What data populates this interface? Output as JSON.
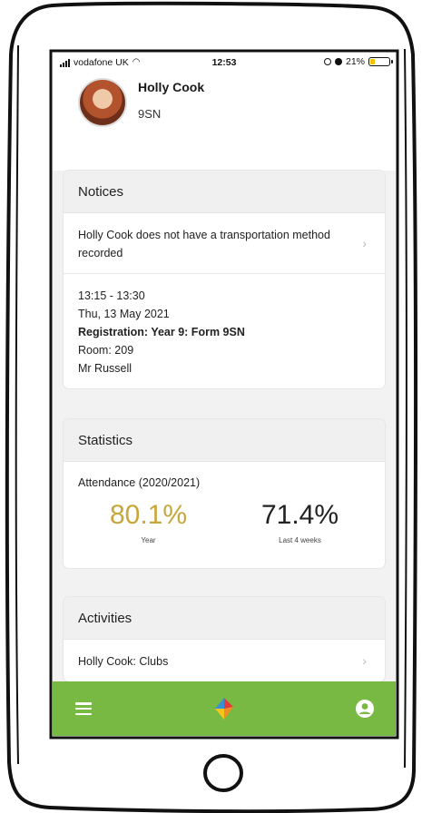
{
  "status_bar": {
    "carrier": "vodafone UK",
    "time": "12:53",
    "battery": "21%"
  },
  "profile": {
    "name": "Holly Cook",
    "form": "9SN"
  },
  "notices": {
    "title": "Notices",
    "transport_notice": "Holly Cook does not have a transportation method recorded",
    "registration": {
      "time": "13:15 - 13:30",
      "date": "Thu, 13 May 2021",
      "title": "Registration: Year 9: Form 9SN",
      "room": "Room: 209",
      "teacher": "Mr Russell"
    }
  },
  "statistics": {
    "title": "Statistics",
    "attendance_label": "Attendance (2020/2021)",
    "year_value": "80.1%",
    "year_caption": "Year",
    "weeks_value": "71.4%",
    "weeks_caption": "Last 4 weeks"
  },
  "activities": {
    "title": "Activities",
    "clubs_label": "Holly Cook: Clubs"
  },
  "colors": {
    "accent_green": "#78b943",
    "year_stat_gold": "#c9a63b"
  },
  "icons": {
    "menu": "menu-icon",
    "logo": "app-logo-icon",
    "account": "account-icon",
    "chevron": "chevron-right-icon"
  }
}
